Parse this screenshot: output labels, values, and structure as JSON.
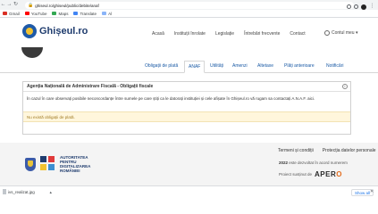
{
  "browser": {
    "url": "ghiseul.ro/ghiseul/public/debite/anaf",
    "bookmarks": [
      {
        "label": "Gmail",
        "icon": "gmail-icon",
        "color": "#d93025"
      },
      {
        "label": "YouTube",
        "icon": "youtube-icon",
        "color": "#ff0000"
      },
      {
        "label": "Maps",
        "icon": "maps-icon",
        "color": "#34a853"
      },
      {
        "label": "Translate",
        "icon": "translate-icon",
        "color": "#4285f4"
      },
      {
        "label": "Al",
        "icon": "bookmark-icon",
        "color": "#8ab4f8"
      }
    ]
  },
  "header": {
    "logo_text": "Ghișeul.ro",
    "nav": [
      "Acasă",
      "Instituții înrolate",
      "Legislație",
      "Întrebări frecvente",
      "Contact"
    ],
    "account": "Contul meu"
  },
  "tabs": [
    {
      "label": "Obligații de plată",
      "active": false
    },
    {
      "label": "ANAF",
      "active": true
    },
    {
      "label": "Utilități",
      "active": false
    },
    {
      "label": "Amenzi",
      "active": false
    },
    {
      "label": "Altetaxe",
      "active": false
    },
    {
      "label": "Plăți anterioare",
      "active": false
    },
    {
      "label": "Notificări",
      "active": false
    }
  ],
  "panel": {
    "title": "Agenția Națională de Administrare Fiscală - Obligații fiscale",
    "info": "i",
    "text": "În cazul în care observați posibile neconcordanțe între sumele pe care știți ca le datorați instituției și cele afișate în Ghișeul.ro vă rugam sa contactați A.N.A.F. aici.",
    "alert": "Nu există obligații de plată."
  },
  "footer": {
    "adi_lines": [
      "AUTORITATEA",
      "PENTRU",
      "DIGITALIZAREA",
      "ROMÂNIEI"
    ],
    "links": [
      "Termeni și condiții",
      "Protecția datelor personale"
    ],
    "meta_year": "2022",
    "meta_rest": "este dezvoltat în acord numerem",
    "project_label": "Proiect susținut de",
    "sponsor_a": "APER",
    "sponsor_o": "O"
  },
  "downloads": {
    "file_name": "ivs_realizat.jpg",
    "show_all": "Show all"
  },
  "colors": {
    "brand_blue": "#1f3c6e",
    "link_blue": "#1a5aa5",
    "alert_bg": "#fff6dc",
    "alert_text": "#a07b24"
  }
}
